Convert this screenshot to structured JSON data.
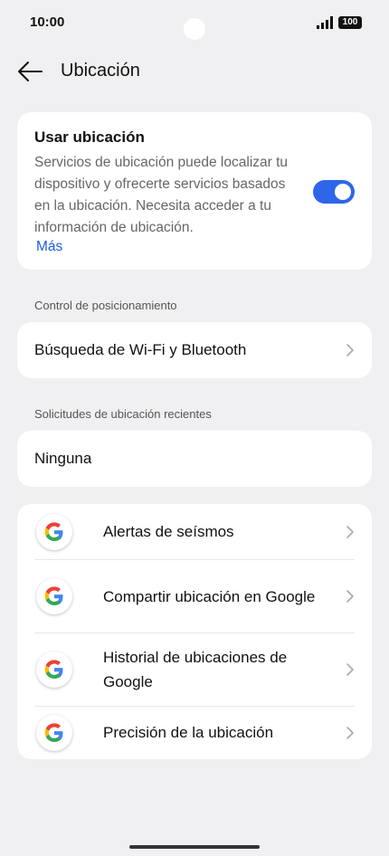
{
  "status_bar": {
    "time": "10:00",
    "battery": "100"
  },
  "header": {
    "title": "Ubicación"
  },
  "location": {
    "title": "Usar ubicación",
    "description": "Servicios de ubicación puede localizar tu dispositivo y ofrecerte servicios basados en la ubicación. Necesita acceder a tu información de ubicación.",
    "more_label": "Más",
    "enabled": true
  },
  "positioning": {
    "section_label": "Control de posicionamiento",
    "item_label": "Búsqueda de Wi-Fi y Bluetooth"
  },
  "recent": {
    "section_label": "Solicitudes de ubicación recientes",
    "item_label": "Ninguna"
  },
  "apps": [
    {
      "label": "Alertas de seísmos",
      "icon": "google-icon"
    },
    {
      "label": "Compartir ubicación en Google",
      "icon": "google-icon"
    },
    {
      "label": "Historial de ubicaciones de Google",
      "icon": "google-icon"
    },
    {
      "label": "Precisión de la ubicación",
      "icon": "google-icon"
    }
  ],
  "colors": {
    "accent": "#2f66e9",
    "link": "#1a5fd8",
    "background": "#f0f0f2"
  }
}
